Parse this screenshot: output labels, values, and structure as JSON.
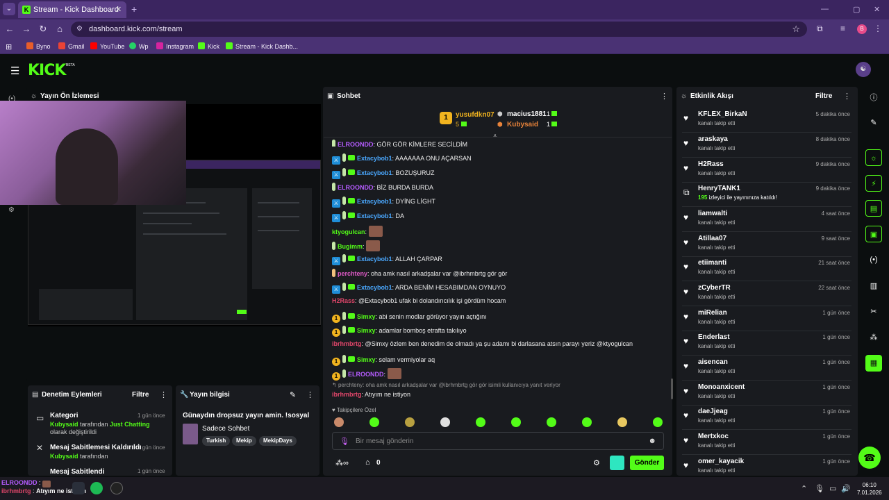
{
  "browser": {
    "tab_title": "Stream - Kick Dashboard",
    "url": "dashboard.kick.com/stream",
    "bookmarks": [
      "Byno",
      "Gmail",
      "YouTube",
      "Wp",
      "Instagram",
      "Kick",
      "Stream - Kick Dashb..."
    ],
    "profile_initial": "B"
  },
  "header": {
    "logo": "KICK",
    "beta": "BETA"
  },
  "preview": {
    "title": "Yayın Ön İzlemesi"
  },
  "moderation": {
    "title": "Denetim Eylemleri",
    "filter": "Filtre",
    "items": [
      {
        "title": "Kategori",
        "actor": "Kubysaid",
        "desc_pre": " tarafından ",
        "highlight": "Just Chatting",
        "desc_post": " olarak değiştirildi",
        "time": "1 gün önce"
      },
      {
        "title": "Mesaj Sabitlemesi Kaldırıldı",
        "actor": "Kubysaid",
        "desc_pre": " tarafından",
        "highlight": "",
        "desc_post": "",
        "time": "1 gün önce"
      },
      {
        "title": "Mesaj Sabitlendi",
        "time": "1 gün önce"
      }
    ]
  },
  "stream_info": {
    "title": "Yayın bilgisi",
    "stream_title": "Günaydın dropsuz yayın amin. !sosyal",
    "category": "Sadece Sohbet",
    "tags": [
      "Turkish",
      "Mekip",
      "MekipDays"
    ]
  },
  "chat": {
    "title": "Sohbet",
    "leaderboard": [
      {
        "rank": "1",
        "name": "yusufdkn07",
        "count": "5"
      },
      {
        "rank": "",
        "name": "macius1881",
        "count": "1"
      },
      {
        "rank": "",
        "name": "Kubysaid",
        "count": "1"
      }
    ],
    "messages": [
      {
        "user": "ELROONDD",
        "text": "GÖR GÖR KİMLERE SEÇİLDİM"
      },
      {
        "user": "Extacybob1",
        "text": "AAAAAAA ONU AÇARSAN"
      },
      {
        "user": "Extacybob1",
        "text": "BOZUŞURUZ"
      },
      {
        "user": "ELROONDD",
        "text": "BİZ BURDA BURDA"
      },
      {
        "user": "Extacybob1",
        "text": "DYİNG LİGHT"
      },
      {
        "user": "Extacybob1",
        "text": "DA"
      },
      {
        "user": "ktyogulcan",
        "text": ""
      },
      {
        "user": "Bugimm",
        "text": ""
      },
      {
        "user": "Extacybob1",
        "text": "ALLAH ÇARPAR"
      },
      {
        "user": "perchteny",
        "text": "oha amk nasıl arkadşalar var @ibrhmbrtg gör gör"
      },
      {
        "user": "Extacybob1",
        "text": "ARDA BENİM HESABIMDAN OYNUYO"
      },
      {
        "user": "H2Rass",
        "text": "@Extacybob1 ufak bi dolandırıcılık işi gördüm hocam"
      },
      {
        "user": "Simxy",
        "text": "abi senin modlar görüyor yayın açtığını"
      },
      {
        "user": "Simxy",
        "text": "adamlar bomboş etrafta takılıyo"
      },
      {
        "user": "ibrhmbrtg",
        "text": "@Simxy özlem ben denedim de olmadı ya şu adamı bi darlasana atsın parayı yeriz @ktyogulcan"
      },
      {
        "user": "Simxy",
        "text": "selam vermiyolar aq"
      },
      {
        "user": "ELROONDD",
        "text": ""
      }
    ],
    "reply_context": "perchteny: oha amk nasıl arkadşalar var @ibrhmbrtg gör gör isimli kullanıcıya yanıt veriyor",
    "reply_user": "ibrhmbrtg",
    "reply_text": "Atıyım ne istiyon",
    "followers_label": "Takipçilere Özel",
    "input_placeholder": "Bir mesaj gönderin",
    "count": "0",
    "send": "Gönder"
  },
  "activity": {
    "title": "Etkinlik Akışı",
    "filter": "Filtre",
    "items": [
      {
        "name": "KFLEX_BirkaN",
        "desc": "kanalı takip etti",
        "time": "5 dakika önce"
      },
      {
        "name": "araskaya",
        "desc": "kanalı takip etti",
        "time": "8 dakika önce"
      },
      {
        "name": "H2Rass",
        "desc": "kanalı takip etti",
        "time": "9 dakika önce"
      },
      {
        "name": "HenryTANK1",
        "desc_num": "195",
        "desc": " izleyici ile yayınınıza katıldı!",
        "time": "9 dakika önce"
      },
      {
        "name": "liamwalti",
        "desc": "kanalı takip etti",
        "time": "4 saat önce"
      },
      {
        "name": "Atillaa07",
        "desc": "kanalı takip etti",
        "time": "9 saat önce"
      },
      {
        "name": "etiimanti",
        "desc": "kanalı takip etti",
        "time": "21 saat önce"
      },
      {
        "name": "zCyberTR",
        "desc": "kanalı takip etti",
        "time": "22 saat önce"
      },
      {
        "name": "miRelian",
        "desc": "kanalı takip etti",
        "time": "1 gün önce"
      },
      {
        "name": "Enderlast",
        "desc": "kanalı takip etti",
        "time": "1 gün önce"
      },
      {
        "name": "aisencan",
        "desc": "kanalı takip etti",
        "time": "1 gün önce"
      },
      {
        "name": "Monoanxicent",
        "desc": "kanalı takip etti",
        "time": "1 gün önce"
      },
      {
        "name": "daeJjeag",
        "desc": "kanalı takip etti",
        "time": "1 gün önce"
      },
      {
        "name": "Mertxkoc",
        "desc": "kanalı takip etti",
        "time": "1 gün önce"
      },
      {
        "name": "omer_kayacik",
        "desc": "kanalı takip etti",
        "time": "1 gün önce"
      }
    ]
  },
  "taskbar": {
    "notif_user": "ELROONDD",
    "notif_user2": "ibrhmbrtg",
    "notif_text": "Atıyım ne istiyon",
    "time": "06:10",
    "date": "7.01.2026"
  },
  "colors": {
    "accent": "#53fc18",
    "chrome": "#4a3274",
    "panel": "#191b1f",
    "bg": "#0b0e0f"
  }
}
